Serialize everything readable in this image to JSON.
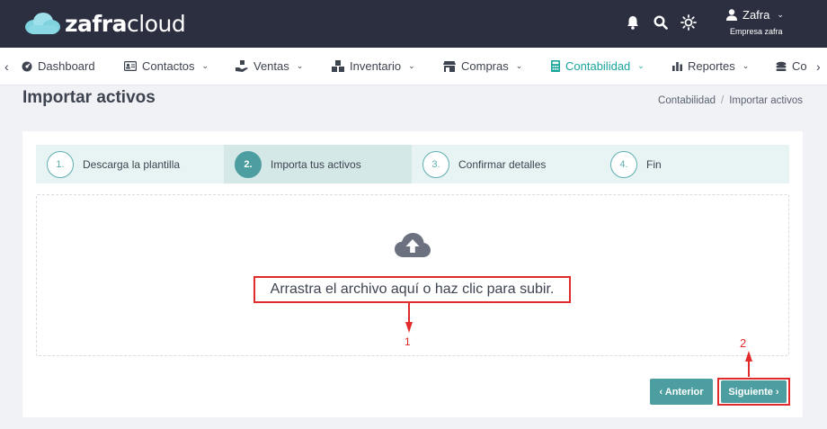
{
  "brand": {
    "bold": "zafra",
    "light": "cloud"
  },
  "user": {
    "name": "Zafra",
    "company": "Empresa zafra"
  },
  "nav": {
    "prev_arrow": "‹",
    "next_arrow": "›",
    "items": [
      {
        "label": "Dashboard",
        "icon": "dashboard-icon"
      },
      {
        "label": "Contactos",
        "icon": "contacts-icon"
      },
      {
        "label": "Ventas",
        "icon": "sales-icon"
      },
      {
        "label": "Inventario",
        "icon": "inventory-icon"
      },
      {
        "label": "Compras",
        "icon": "store-icon"
      },
      {
        "label": "Contabilidad",
        "icon": "calculator-icon",
        "active": true
      },
      {
        "label": "Reportes",
        "icon": "bar-chart-icon"
      },
      {
        "label": "Co",
        "icon": "coins-icon"
      }
    ]
  },
  "page": {
    "title": "Importar activos",
    "breadcrumb": [
      "Contabilidad",
      "Importar activos"
    ],
    "breadcrumb_sep": "/"
  },
  "steps": [
    {
      "num": "1.",
      "label": "Descarga la plantilla"
    },
    {
      "num": "2.",
      "label": "Importa tus activos",
      "active": true
    },
    {
      "num": "3.",
      "label": "Confirmar detalles"
    },
    {
      "num": "4.",
      "label": "Fin"
    }
  ],
  "dropzone": {
    "text": "Arrastra el archivo aquí o haz clic para subir."
  },
  "annotations": {
    "one": "1",
    "two": "2"
  },
  "buttons": {
    "prev": "‹ Anterior",
    "next": "Siguiente ›"
  },
  "colors": {
    "topbar": "#2c2f40",
    "accent": "#4d9ea0",
    "active_nav": "#1aa49b",
    "annotation": "#e12a2a"
  }
}
